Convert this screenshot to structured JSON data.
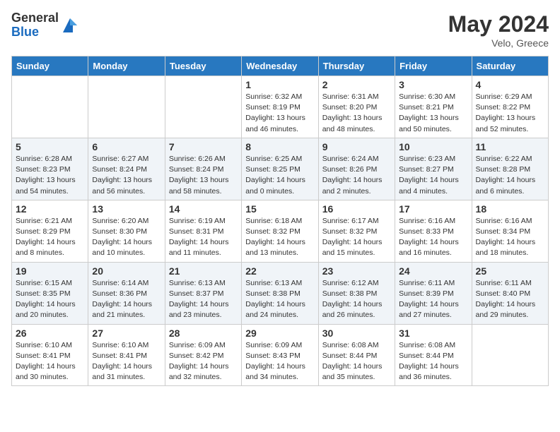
{
  "header": {
    "logo_general": "General",
    "logo_blue": "Blue",
    "month_year": "May 2024",
    "location": "Velo, Greece"
  },
  "weekdays": [
    "Sunday",
    "Monday",
    "Tuesday",
    "Wednesday",
    "Thursday",
    "Friday",
    "Saturday"
  ],
  "weeks": [
    [
      {
        "day": "",
        "sunrise": "",
        "sunset": "",
        "daylight": ""
      },
      {
        "day": "",
        "sunrise": "",
        "sunset": "",
        "daylight": ""
      },
      {
        "day": "",
        "sunrise": "",
        "sunset": "",
        "daylight": ""
      },
      {
        "day": "1",
        "sunrise": "Sunrise: 6:32 AM",
        "sunset": "Sunset: 8:19 PM",
        "daylight": "Daylight: 13 hours and 46 minutes."
      },
      {
        "day": "2",
        "sunrise": "Sunrise: 6:31 AM",
        "sunset": "Sunset: 8:20 PM",
        "daylight": "Daylight: 13 hours and 48 minutes."
      },
      {
        "day": "3",
        "sunrise": "Sunrise: 6:30 AM",
        "sunset": "Sunset: 8:21 PM",
        "daylight": "Daylight: 13 hours and 50 minutes."
      },
      {
        "day": "4",
        "sunrise": "Sunrise: 6:29 AM",
        "sunset": "Sunset: 8:22 PM",
        "daylight": "Daylight: 13 hours and 52 minutes."
      }
    ],
    [
      {
        "day": "5",
        "sunrise": "Sunrise: 6:28 AM",
        "sunset": "Sunset: 8:23 PM",
        "daylight": "Daylight: 13 hours and 54 minutes."
      },
      {
        "day": "6",
        "sunrise": "Sunrise: 6:27 AM",
        "sunset": "Sunset: 8:24 PM",
        "daylight": "Daylight: 13 hours and 56 minutes."
      },
      {
        "day": "7",
        "sunrise": "Sunrise: 6:26 AM",
        "sunset": "Sunset: 8:24 PM",
        "daylight": "Daylight: 13 hours and 58 minutes."
      },
      {
        "day": "8",
        "sunrise": "Sunrise: 6:25 AM",
        "sunset": "Sunset: 8:25 PM",
        "daylight": "Daylight: 14 hours and 0 minutes."
      },
      {
        "day": "9",
        "sunrise": "Sunrise: 6:24 AM",
        "sunset": "Sunset: 8:26 PM",
        "daylight": "Daylight: 14 hours and 2 minutes."
      },
      {
        "day": "10",
        "sunrise": "Sunrise: 6:23 AM",
        "sunset": "Sunset: 8:27 PM",
        "daylight": "Daylight: 14 hours and 4 minutes."
      },
      {
        "day": "11",
        "sunrise": "Sunrise: 6:22 AM",
        "sunset": "Sunset: 8:28 PM",
        "daylight": "Daylight: 14 hours and 6 minutes."
      }
    ],
    [
      {
        "day": "12",
        "sunrise": "Sunrise: 6:21 AM",
        "sunset": "Sunset: 8:29 PM",
        "daylight": "Daylight: 14 hours and 8 minutes."
      },
      {
        "day": "13",
        "sunrise": "Sunrise: 6:20 AM",
        "sunset": "Sunset: 8:30 PM",
        "daylight": "Daylight: 14 hours and 10 minutes."
      },
      {
        "day": "14",
        "sunrise": "Sunrise: 6:19 AM",
        "sunset": "Sunset: 8:31 PM",
        "daylight": "Daylight: 14 hours and 11 minutes."
      },
      {
        "day": "15",
        "sunrise": "Sunrise: 6:18 AM",
        "sunset": "Sunset: 8:32 PM",
        "daylight": "Daylight: 14 hours and 13 minutes."
      },
      {
        "day": "16",
        "sunrise": "Sunrise: 6:17 AM",
        "sunset": "Sunset: 8:32 PM",
        "daylight": "Daylight: 14 hours and 15 minutes."
      },
      {
        "day": "17",
        "sunrise": "Sunrise: 6:16 AM",
        "sunset": "Sunset: 8:33 PM",
        "daylight": "Daylight: 14 hours and 16 minutes."
      },
      {
        "day": "18",
        "sunrise": "Sunrise: 6:16 AM",
        "sunset": "Sunset: 8:34 PM",
        "daylight": "Daylight: 14 hours and 18 minutes."
      }
    ],
    [
      {
        "day": "19",
        "sunrise": "Sunrise: 6:15 AM",
        "sunset": "Sunset: 8:35 PM",
        "daylight": "Daylight: 14 hours and 20 minutes."
      },
      {
        "day": "20",
        "sunrise": "Sunrise: 6:14 AM",
        "sunset": "Sunset: 8:36 PM",
        "daylight": "Daylight: 14 hours and 21 minutes."
      },
      {
        "day": "21",
        "sunrise": "Sunrise: 6:13 AM",
        "sunset": "Sunset: 8:37 PM",
        "daylight": "Daylight: 14 hours and 23 minutes."
      },
      {
        "day": "22",
        "sunrise": "Sunrise: 6:13 AM",
        "sunset": "Sunset: 8:38 PM",
        "daylight": "Daylight: 14 hours and 24 minutes."
      },
      {
        "day": "23",
        "sunrise": "Sunrise: 6:12 AM",
        "sunset": "Sunset: 8:38 PM",
        "daylight": "Daylight: 14 hours and 26 minutes."
      },
      {
        "day": "24",
        "sunrise": "Sunrise: 6:11 AM",
        "sunset": "Sunset: 8:39 PM",
        "daylight": "Daylight: 14 hours and 27 minutes."
      },
      {
        "day": "25",
        "sunrise": "Sunrise: 6:11 AM",
        "sunset": "Sunset: 8:40 PM",
        "daylight": "Daylight: 14 hours and 29 minutes."
      }
    ],
    [
      {
        "day": "26",
        "sunrise": "Sunrise: 6:10 AM",
        "sunset": "Sunset: 8:41 PM",
        "daylight": "Daylight: 14 hours and 30 minutes."
      },
      {
        "day": "27",
        "sunrise": "Sunrise: 6:10 AM",
        "sunset": "Sunset: 8:41 PM",
        "daylight": "Daylight: 14 hours and 31 minutes."
      },
      {
        "day": "28",
        "sunrise": "Sunrise: 6:09 AM",
        "sunset": "Sunset: 8:42 PM",
        "daylight": "Daylight: 14 hours and 32 minutes."
      },
      {
        "day": "29",
        "sunrise": "Sunrise: 6:09 AM",
        "sunset": "Sunset: 8:43 PM",
        "daylight": "Daylight: 14 hours and 34 minutes."
      },
      {
        "day": "30",
        "sunrise": "Sunrise: 6:08 AM",
        "sunset": "Sunset: 8:44 PM",
        "daylight": "Daylight: 14 hours and 35 minutes."
      },
      {
        "day": "31",
        "sunrise": "Sunrise: 6:08 AM",
        "sunset": "Sunset: 8:44 PM",
        "daylight": "Daylight: 14 hours and 36 minutes."
      },
      {
        "day": "",
        "sunrise": "",
        "sunset": "",
        "daylight": ""
      }
    ]
  ]
}
